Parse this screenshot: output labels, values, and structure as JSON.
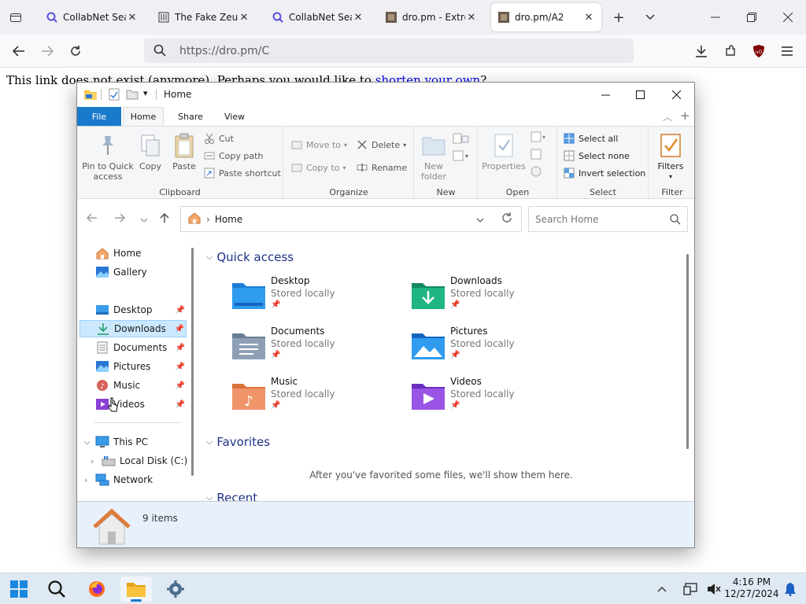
{
  "browser": {
    "tabs": [
      {
        "title": "CollabNet SearX",
        "icon": "search-icon"
      },
      {
        "title": "The Fake Zeus Vi",
        "icon": "temple-icon"
      },
      {
        "title": "CollabNet SearX",
        "icon": "search-icon"
      },
      {
        "title": "dro.pm - Extrem",
        "icon": "dro-favicon"
      },
      {
        "title": "dro.pm/A2",
        "icon": "dro-favicon",
        "active": true
      }
    ],
    "url": "https://dro.pm/C",
    "page_text": "This link does not exist (anymore). Perhaps you would like to ",
    "page_link": "shorten your own",
    "page_after": "?"
  },
  "explorer": {
    "title": "Home",
    "ribbon_tabs": {
      "file": "File",
      "home": "Home",
      "share": "Share",
      "view": "View"
    },
    "clipboard": {
      "pin": "Pin to Quick access",
      "copy": "Copy",
      "paste": "Paste",
      "cut": "Cut",
      "copy_path": "Copy path",
      "paste_shortcut": "Paste shortcut",
      "group": "Clipboard"
    },
    "organize": {
      "move_to": "Move to",
      "copy_to": "Copy to",
      "delete": "Delete",
      "rename": "Rename",
      "group": "Organize"
    },
    "new": {
      "new_folder": "New folder",
      "group": "New"
    },
    "open": {
      "properties": "Properties",
      "group": "Open"
    },
    "select": {
      "select_all": "Select all",
      "select_none": "Select none",
      "invert": "Invert selection",
      "group": "Select"
    },
    "filter": {
      "filters": "Filters",
      "group": "Filter"
    },
    "address": {
      "location": "Home",
      "search_placeholder": "Search Home"
    },
    "nav": {
      "home": "Home",
      "gallery": "Gallery",
      "desktop": "Desktop",
      "downloads": "Downloads",
      "documents": "Documents",
      "pictures": "Pictures",
      "music": "Music",
      "videos": "Videos",
      "this_pc": "This PC",
      "local_disk": "Local Disk (C:)",
      "network": "Network"
    },
    "quick_access": {
      "heading": "Quick access",
      "items": [
        {
          "name": "Desktop",
          "status": "Stored locally"
        },
        {
          "name": "Downloads",
          "status": "Stored locally"
        },
        {
          "name": "Documents",
          "status": "Stored locally"
        },
        {
          "name": "Pictures",
          "status": "Stored locally"
        },
        {
          "name": "Music",
          "status": "Stored locally"
        },
        {
          "name": "Videos",
          "status": "Stored locally"
        }
      ]
    },
    "favorites": {
      "heading": "Favorites",
      "empty_text": "After you've favorited some files, we'll show them here."
    },
    "recent": {
      "heading": "Recent"
    },
    "status": {
      "count": "9 items"
    }
  },
  "taskbar": {
    "time": "4:16 PM",
    "date": "12/27/2024"
  },
  "colors": {
    "accent": "#1979ca",
    "link": "#0000ee",
    "selection": "#cce8ff"
  }
}
